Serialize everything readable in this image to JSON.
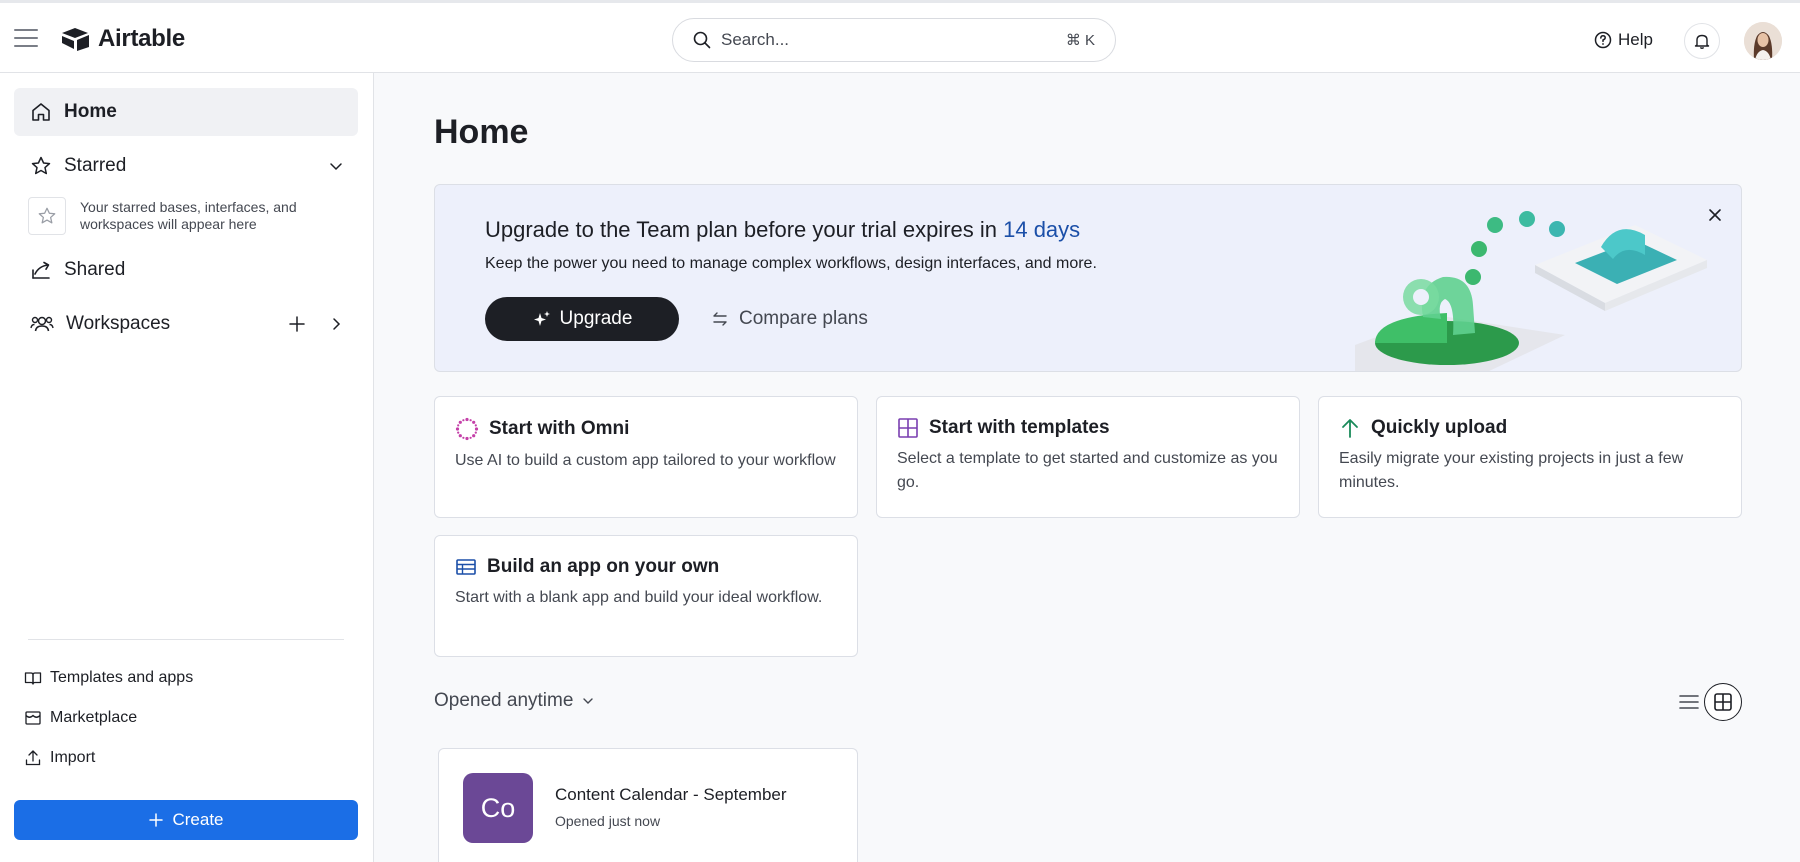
{
  "app": {
    "name": "Airtable"
  },
  "header": {
    "search_placeholder": "Search...",
    "search_shortcut": "⌘ K",
    "help_label": "Help"
  },
  "sidebar": {
    "home": "Home",
    "starred": "Starred",
    "starred_hint": "Your starred bases, interfaces, and workspaces will appear here",
    "shared": "Shared",
    "workspaces": "Workspaces",
    "footer_links": [
      "Templates and apps",
      "Marketplace",
      "Import"
    ],
    "create_label": "Create"
  },
  "main": {
    "title": "Home",
    "banner": {
      "title_prefix": "Upgrade to the Team plan before your trial expires in ",
      "title_days": "14 days",
      "subtitle": "Keep the power you need to manage complex workflows, design interfaces, and more.",
      "upgrade_label": "Upgrade",
      "compare_label": "Compare plans"
    },
    "cards": [
      {
        "title": "Start with Omni",
        "desc": "Use AI to build a custom app tailored to your workflow"
      },
      {
        "title": "Start with templates",
        "desc": "Select a template to get started and customize as you go."
      },
      {
        "title": "Quickly upload",
        "desc": "Easily migrate your existing projects in just a few minutes."
      },
      {
        "title": "Build an app on your own",
        "desc": "Start with a blank app and build your ideal workflow."
      }
    ],
    "opened_filter": "Opened anytime",
    "bases": [
      {
        "initials": "Co",
        "name": "Content Calendar - September",
        "subtitle": "Opened just now",
        "color": "#6b4896"
      }
    ]
  },
  "colors": {
    "primary": "#1b6ee6",
    "dark": "#1d1f25",
    "accent_days": "#1b4fa8"
  }
}
